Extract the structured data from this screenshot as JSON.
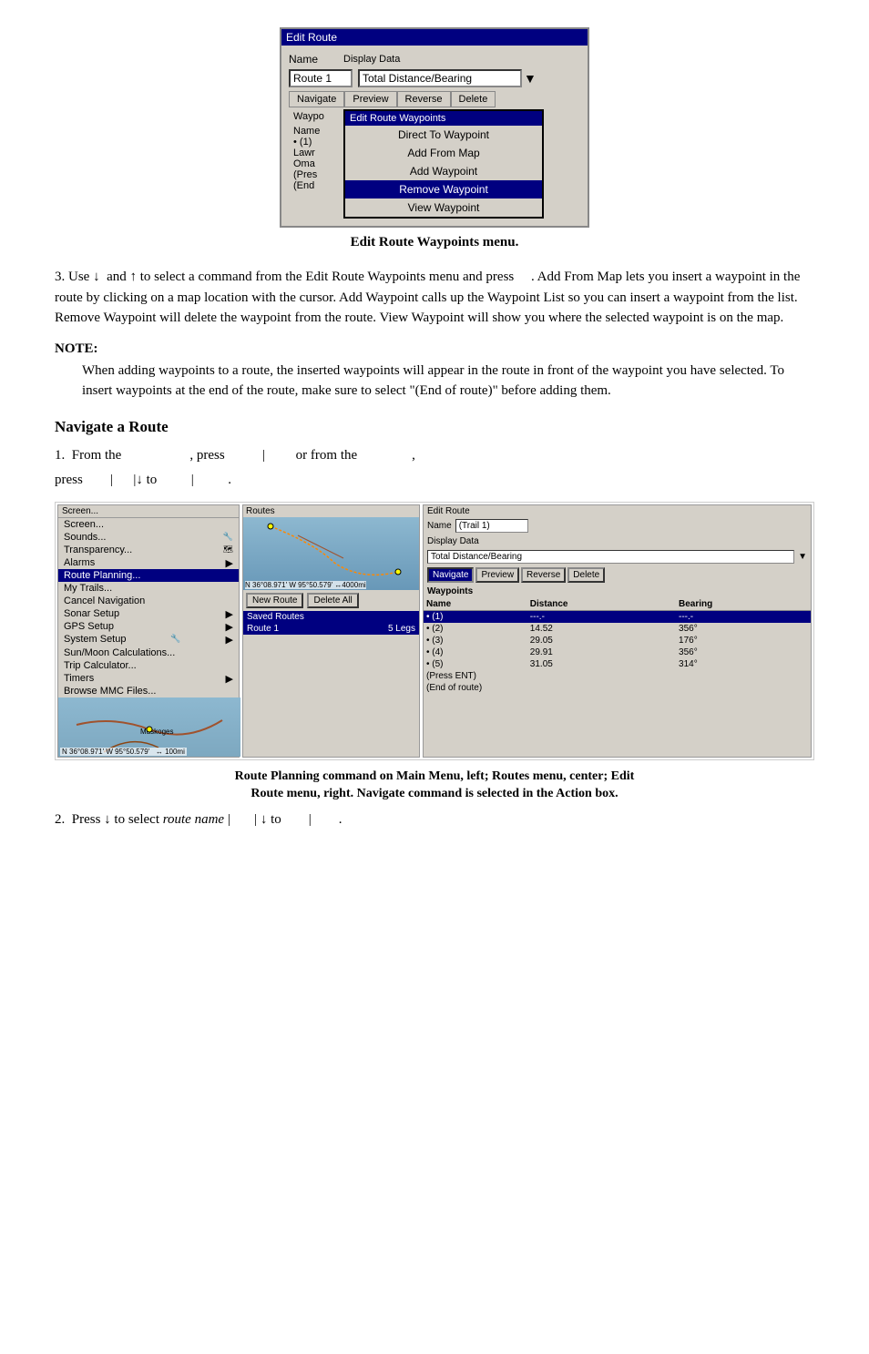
{
  "dialog": {
    "title": "Edit Route",
    "name_label": "Name",
    "name_value": "Route 1",
    "display_label": "Display Data",
    "display_value": "Total Distance/Bearing",
    "tabs": [
      "Navigate",
      "Preview",
      "Reverse",
      "Delete"
    ],
    "popup_title": "Edit Route Waypoints",
    "popup_items": [
      {
        "label": "Direct To Waypoint",
        "selected": false
      },
      {
        "label": "Add From Map",
        "selected": false
      },
      {
        "label": "Add Waypoint",
        "selected": false
      },
      {
        "label": "Remove Waypoint",
        "selected": true
      },
      {
        "label": "View Waypoint",
        "selected": false
      }
    ],
    "waypoints_label": "Waypoints",
    "waypoints": [
      "Name",
      "(1)",
      "Lawn",
      "Oma",
      "(Pres",
      "(End"
    ]
  },
  "caption1": "Edit Route Waypoints menu.",
  "paragraph1": "3. Use ↓  and ↑ to select a command from the Edit Route Waypoints menu and press     . Add From Map lets you insert a waypoint in the route by clicking on a map location with the cursor. Add Waypoint calls up the Waypoint List so you can insert a waypoint from the list. Remove Waypoint will delete the waypoint from the route. View Waypoint will show you where the selected waypoint is on the map.",
  "note": {
    "title": "NOTE:",
    "body": "When adding waypoints to a route, the inserted waypoints will appear in the route in front of the waypoint you have selected. To insert waypoints at the end of the route, make sure to select \"(End of route)\" before adding them."
  },
  "section_title": "Navigate a Route",
  "nav_line1_a": "1.  From the",
  "nav_line1_b": ", press",
  "nav_line1_c": "|",
  "nav_line1_d": "or from the",
  "nav_line1_e": ",",
  "nav_line2_a": "press",
  "nav_line2_b": "|",
  "nav_line2_c": "↓ to",
  "nav_line2_d": "|",
  "nav_line2_e": ".",
  "panels": {
    "left": {
      "title": "Screen...",
      "items": [
        {
          "label": "Screen...",
          "selected": false,
          "arrow": false
        },
        {
          "label": "Sounds...",
          "selected": false,
          "arrow": false
        },
        {
          "label": "Transparency...",
          "selected": false,
          "arrow": false
        },
        {
          "label": "Alarms",
          "selected": false,
          "arrow": true
        },
        {
          "label": "Route Planning...",
          "selected": false,
          "arrow": false
        },
        {
          "label": "My Trails...",
          "selected": false,
          "arrow": false
        },
        {
          "label": "Cancel Navigation",
          "selected": false,
          "arrow": false
        },
        {
          "label": "Sonar Setup",
          "selected": false,
          "arrow": true
        },
        {
          "label": "GPS Setup",
          "selected": false,
          "arrow": true
        },
        {
          "label": "System Setup",
          "selected": false,
          "arrow": true
        },
        {
          "label": "Sun/Moon Calculations...",
          "selected": false,
          "arrow": false
        },
        {
          "label": "Trip Calculator...",
          "selected": false,
          "arrow": false
        },
        {
          "label": "Timers",
          "selected": false,
          "arrow": true
        },
        {
          "label": "Browse MMC Files...",
          "selected": false,
          "arrow": false
        }
      ],
      "coord": "N 36°08.971'  W  95°50.579'",
      "scale": "↔ 100mi"
    },
    "center": {
      "title": "Routes",
      "new_route_btn": "New Route",
      "delete_all_btn": "Delete All",
      "saved_routes_label": "Saved Routes",
      "routes": [
        {
          "name": "Route 1",
          "legs": "5 Legs",
          "selected": true
        }
      ],
      "coord": "N 36°08.971'  W  95°50.579'",
      "scale": "↔4000mi"
    },
    "right": {
      "title": "Edit Route",
      "name_label": "Name",
      "display_label": "Display Data",
      "name_value": "(Trail 1)",
      "display_value": "Total Distance/Bearing",
      "action_buttons": [
        "Navigate",
        "Preview",
        "Reverse",
        "Delete"
      ],
      "selected_action": "Navigate",
      "waypoints_header": [
        "Name",
        "Distance",
        "Bearing"
      ],
      "waypoints": [
        {
          "name": "• (1)",
          "distance": "---.-",
          "bearing": "---.-",
          "selected": true
        },
        {
          "name": "• (2)",
          "distance": "14.52",
          "bearing": "356°"
        },
        {
          "name": "• (3)",
          "distance": "29.05",
          "bearing": "176°"
        },
        {
          "name": "• (4)",
          "distance": "29.91",
          "bearing": "356°"
        },
        {
          "name": "• (5)",
          "distance": "31.05",
          "bearing": "314°"
        },
        {
          "name": "(Press ENT)",
          "distance": "",
          "bearing": ""
        },
        {
          "name": "(End of route)",
          "distance": "",
          "bearing": ""
        }
      ]
    }
  },
  "caption2_line1": "Route Planning command on Main Menu, left; Routes menu, center; Edit",
  "caption2_line2": "Route menu, right. Navigate command is selected in the Action box.",
  "press_row": "2.  Press ↓ to select route name |     | ↓ to     |     ."
}
